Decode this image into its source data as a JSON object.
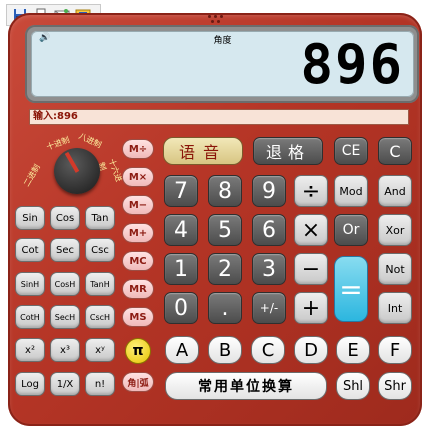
{
  "toolbar": {
    "icons": [
      "save-icon",
      "print-icon",
      "email-icon",
      "settings-icon"
    ]
  },
  "display": {
    "mode": "角度",
    "value": "896",
    "speaker_icon": "🔊"
  },
  "input": {
    "text": "输入:896"
  },
  "dial": {
    "labels": [
      "二进制",
      "十进制",
      "八进制",
      "十六进制"
    ]
  },
  "scientific": [
    [
      "Sin",
      "Cos",
      "Tan"
    ],
    [
      "Cot",
      "Sec",
      "Csc"
    ],
    [
      "SinH",
      "CosH",
      "TanH"
    ],
    [
      "CotH",
      "SecH",
      "CscH"
    ],
    [
      "x²",
      "x³",
      "xʸ"
    ],
    [
      "Log",
      "1/X",
      "n!"
    ]
  ],
  "memory": [
    "M÷",
    "M×",
    "M−",
    "M+",
    "MC",
    "MR",
    "MS"
  ],
  "pi": "π",
  "angle_toggle": "角|弧",
  "top_keys": {
    "voice": "语音",
    "backspace": "退格",
    "ce": "CE",
    "c": "C"
  },
  "numpad": {
    "row1": [
      "7",
      "8",
      "9",
      "÷",
      "Mod",
      "And"
    ],
    "row2": [
      "4",
      "5",
      "6",
      "×",
      "Or",
      "Xor"
    ],
    "row3": [
      "1",
      "2",
      "3",
      "−",
      "Not"
    ],
    "row4": [
      "0",
      ".",
      "+/-",
      "+",
      "Int"
    ],
    "equals": "="
  },
  "hex_keys": [
    "A",
    "B",
    "C",
    "D",
    "E",
    "F"
  ],
  "unit_convert": "常用单位换算",
  "shift_keys": [
    "Shl",
    "Shr"
  ]
}
